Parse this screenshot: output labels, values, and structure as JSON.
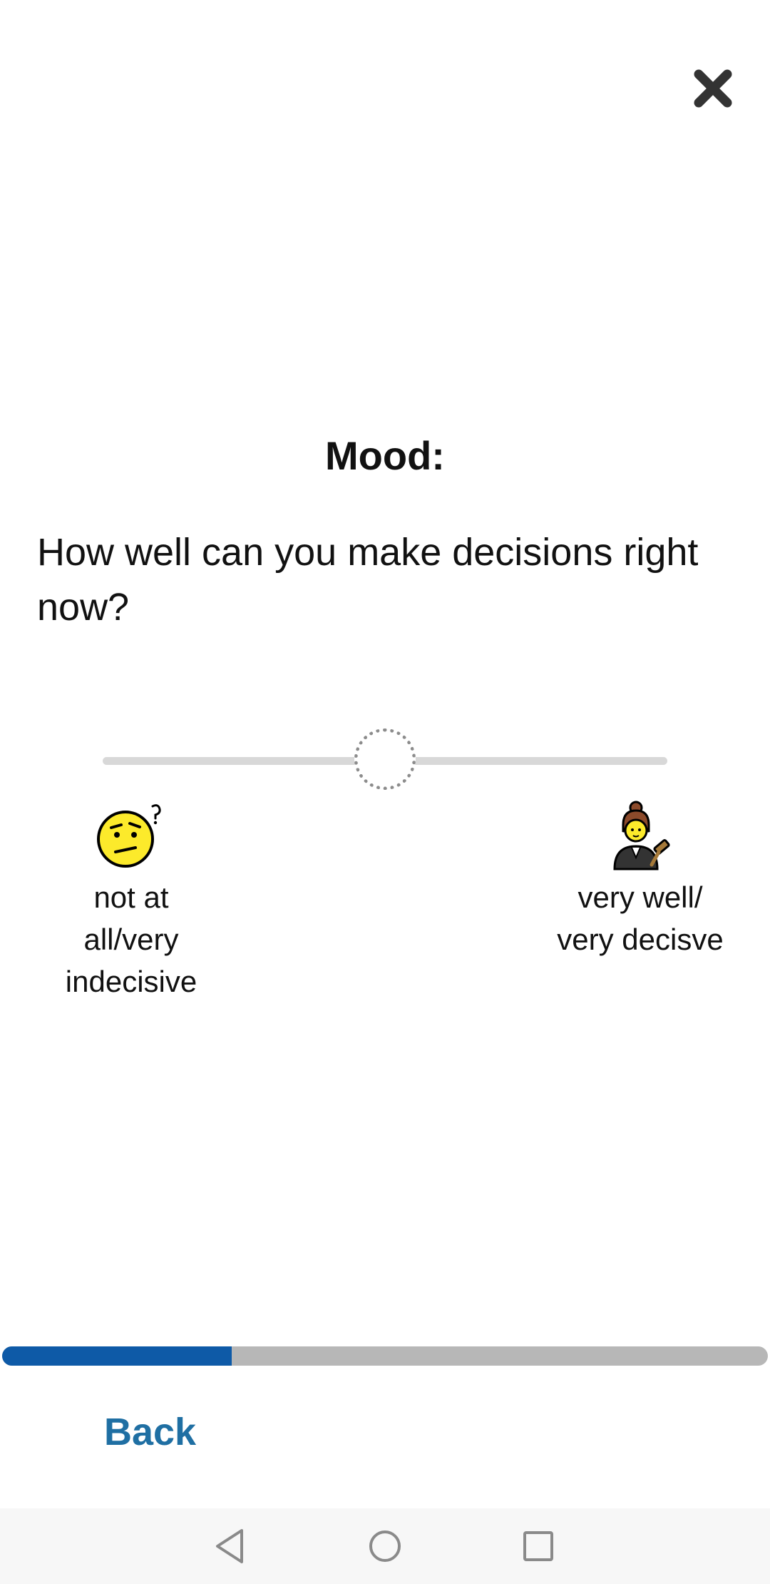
{
  "header": {
    "close_icon": "close-icon"
  },
  "section_title": "Mood:",
  "question": "How well can you make decisions right now?",
  "slider": {
    "min_value": 0,
    "max_value": 1,
    "value": 0.5,
    "track_color": "#d8d8d8",
    "thumb_style": "dotted-outline"
  },
  "anchors": {
    "left": {
      "icon": "confused-face-icon",
      "lines": [
        "not at",
        "all/very",
        "indecisive"
      ]
    },
    "right": {
      "icon": "judge-woman-icon",
      "lines": [
        "very well/",
        "very decisve"
      ]
    }
  },
  "progress": {
    "fraction": 0.3,
    "fill_color": "#0e5aa7",
    "track_color": "#b7b7b7"
  },
  "footer": {
    "back_label": "Back",
    "back_color": "#1f6fa3"
  },
  "nav_bar": {
    "back_icon": "nav-back-icon",
    "home_icon": "nav-home-icon",
    "recents_icon": "nav-recents-icon"
  }
}
